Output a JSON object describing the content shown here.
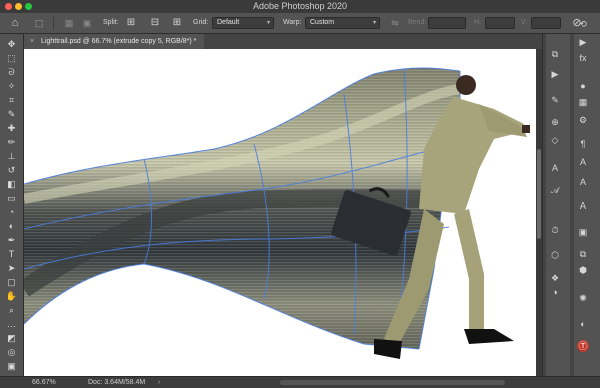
{
  "window": {
    "title": "Adobe Photoshop 2020"
  },
  "colors": {
    "close": "#ff5f57",
    "minimize": "#febc2e",
    "zoom": "#28c840",
    "path": "#4a7de0"
  },
  "options_bar": {
    "home_icon": "home-icon",
    "split_label": "Split:",
    "grid_label": "Grid:",
    "grid_value": "Default",
    "warp_label": "Warp:",
    "warp_value": "Custom",
    "bend_label": "Bend:",
    "h_label": "H:",
    "v_label": "V:"
  },
  "document_tab": {
    "name": "Lighttrail.psd @ 66.7% (extrude copy 5, RGB/8*) *"
  },
  "tools": [
    "move-icon",
    "marquee-icon",
    "lasso-icon",
    "magic-wand-icon",
    "crop-icon",
    "eyedropper-icon",
    "healing-icon",
    "brush-icon",
    "clone-stamp-icon",
    "history-brush-icon",
    "eraser-icon",
    "gradient-icon",
    "blur-icon",
    "dodge-icon",
    "pen-icon",
    "type-icon",
    "path-selection-icon",
    "rectangle-icon",
    "hand-icon",
    "zoom-icon",
    "more-tools-icon",
    "colors-icon",
    "quick-mask-icon",
    "screen-mode-icon"
  ],
  "status": {
    "zoom": "66.67%",
    "doc": "Doc: 3.64M/58.4M"
  }
}
